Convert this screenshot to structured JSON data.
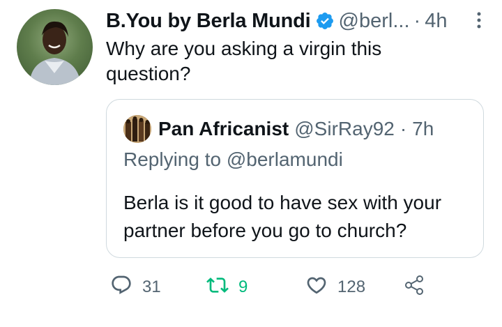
{
  "tweet": {
    "author_name": "B.You by Berla Mundi",
    "author_handle": "@berl...",
    "separator": "·",
    "time": "4h",
    "text": "Why are you asking a virgin this question?"
  },
  "quote": {
    "author_name": "Pan Africanist",
    "author_handle": "@SirRay92",
    "separator": "·",
    "time": "7h",
    "replying_to": "Replying to @berlamundi",
    "text": "Berla is it good to have sex with your partner before you go to church?"
  },
  "actions": {
    "replies": "31",
    "retweets": "9",
    "likes": "128"
  },
  "colors": {
    "verified": "#1d9bf0",
    "retweet_active": "#00ba7c",
    "muted": "#536471",
    "text": "#0f1419"
  },
  "icons": [
    "verified-icon",
    "more-icon",
    "reply-icon",
    "retweet-icon",
    "like-icon",
    "share-icon"
  ]
}
